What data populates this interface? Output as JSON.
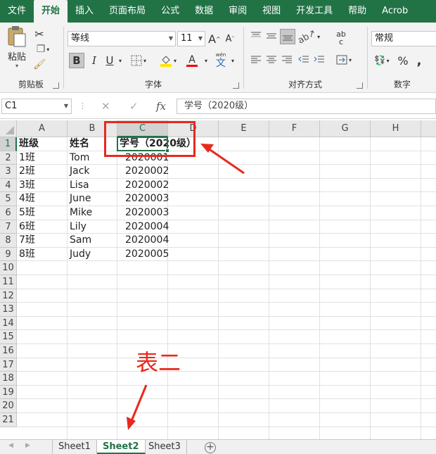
{
  "ribbon_tabs": [
    "文件",
    "开始",
    "插入",
    "页面布局",
    "公式",
    "数据",
    "审阅",
    "视图",
    "开发工具",
    "帮助",
    "Acrob"
  ],
  "active_tab": "开始",
  "clipboard": {
    "paste_label": "粘贴",
    "group_label": "剪贴板"
  },
  "font": {
    "name": "等线",
    "size": "11",
    "group_label": "字体",
    "grow": "A",
    "shrink": "A",
    "bold": "B",
    "italic": "I",
    "underline": "U",
    "phonetic_top": "wén",
    "phonetic_char": "文"
  },
  "alignment": {
    "group_label": "对齐方式",
    "wrap": "ab",
    "wrap_bottom": "c"
  },
  "number": {
    "format": "常规",
    "group_label": "数字",
    "percent": "%",
    "comma": ","
  },
  "formula_bar": {
    "name_box": "C1",
    "fx": "fx",
    "content": "学号（2020级）"
  },
  "columns": [
    "A",
    "B",
    "C",
    "D",
    "E",
    "F",
    "G",
    "H"
  ],
  "rows": [
    "1",
    "2",
    "3",
    "4",
    "5",
    "6",
    "7",
    "8",
    "9",
    "10",
    "11",
    "12",
    "13",
    "14",
    "15",
    "16",
    "17",
    "18",
    "19",
    "20",
    "21"
  ],
  "selected_cell": {
    "column": "C",
    "row": "1"
  },
  "table": {
    "headers": [
      "班级",
      "姓名",
      "学号（2020级）"
    ],
    "records": [
      [
        "1班",
        "Tom",
        "2020001"
      ],
      [
        "2班",
        "Jack",
        "2020002"
      ],
      [
        "3班",
        "Lisa",
        "2020002"
      ],
      [
        "4班",
        "June",
        "2020003"
      ],
      [
        "5班",
        "Mike",
        "2020003"
      ],
      [
        "6班",
        "Lily",
        "2020004"
      ],
      [
        "7班",
        "Sam",
        "2020004"
      ],
      [
        "8班",
        "Judy",
        "2020005"
      ]
    ]
  },
  "annotation": {
    "text": "表二",
    "color": "#e8291c"
  },
  "sheets": [
    "Sheet1",
    "Sheet2",
    "Sheet3"
  ],
  "active_sheet": "Sheet2",
  "add_sheet": "+",
  "colors": {
    "accent": "#217346",
    "annotation": "#e8291c"
  }
}
